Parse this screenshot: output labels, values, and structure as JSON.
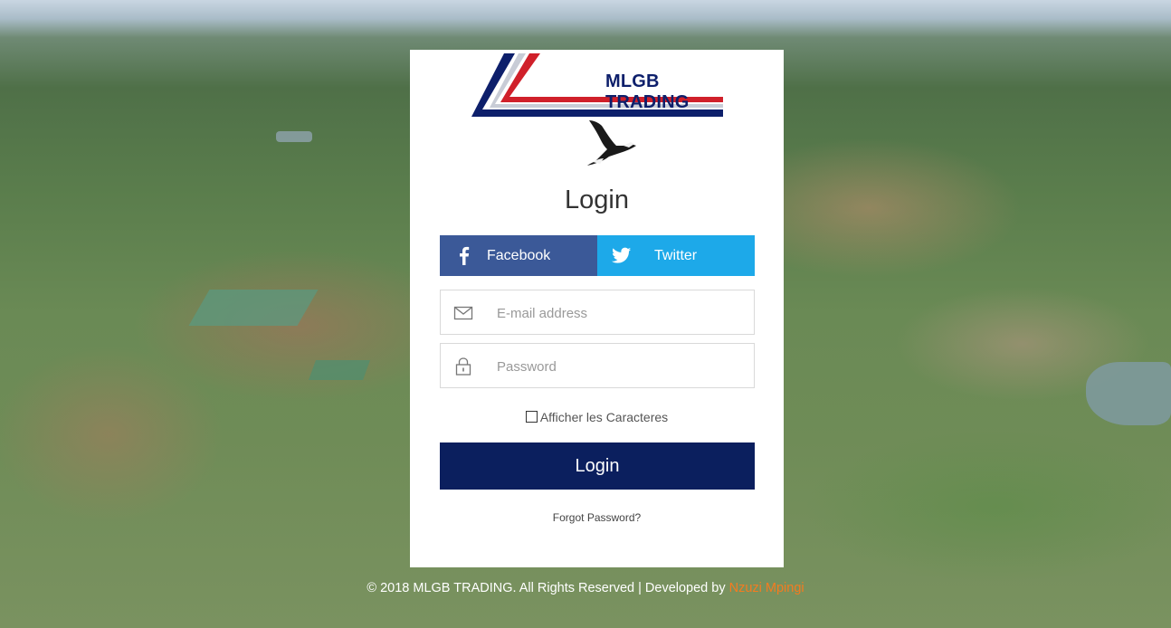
{
  "brand": {
    "logo_text": "MLGB TRADING"
  },
  "login": {
    "title": "Login",
    "social": {
      "facebook_label": "Facebook",
      "twitter_label": "Twitter"
    },
    "email_placeholder": "E-mail address",
    "password_placeholder": "Password",
    "show_chars_label": "Afficher les Caracteres",
    "submit_label": "Login",
    "forgot_label": "Forgot Password?"
  },
  "footer": {
    "text": "© 2018 MLGB TRADING. All Rights Reserved | Developed by ",
    "developer": "Nzuzi Mpingi"
  },
  "colors": {
    "facebook": "#3b5998",
    "twitter": "#1da9e9",
    "primary": "#0b1f5e",
    "developer_link": "#f47b20"
  },
  "icons": [
    "facebook-icon",
    "twitter-icon",
    "envelope-icon",
    "lock-icon",
    "eagle-icon"
  ]
}
